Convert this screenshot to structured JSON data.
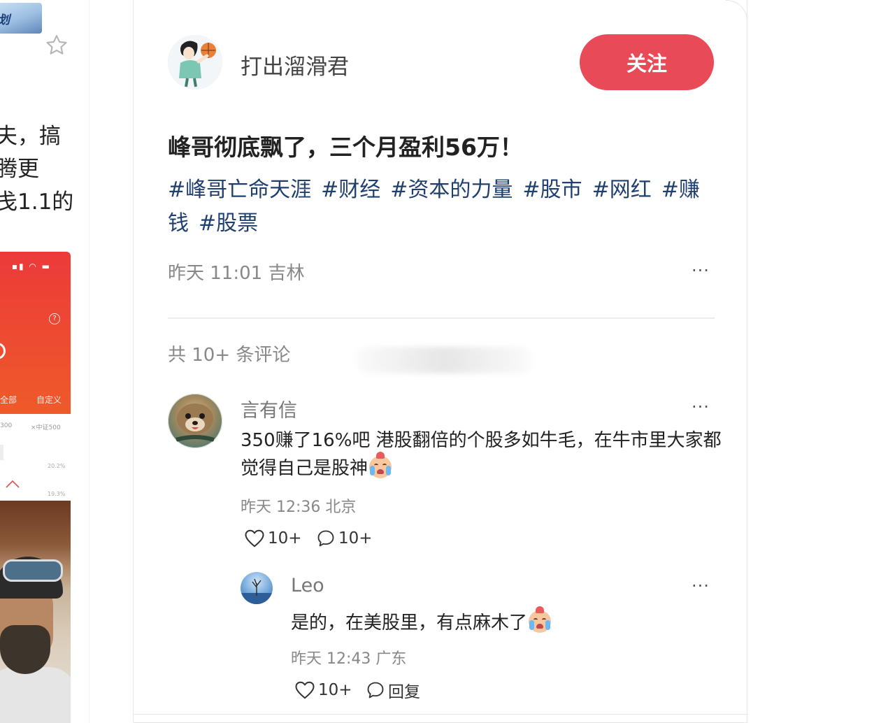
{
  "left_column": {
    "banner_text": "计划",
    "snippet_lines": [
      "夫，搞",
      "腾更",
      "戋1.1的"
    ],
    "phone_tabs": [
      "全部",
      "自定义"
    ],
    "legend_items": [
      "300",
      "×中证500"
    ],
    "percent_labels": [
      "20.2%",
      "19.3%"
    ]
  },
  "post": {
    "author_name": "打出溜滑君",
    "follow_label": "关注",
    "title": "峰哥彻底飘了，三个月盈利56万！",
    "tags": [
      "#峰哥亡命天涯",
      "#财经",
      "#资本的力量",
      "#股市",
      "#网红",
      "#赚钱",
      "#股票"
    ],
    "meta": "昨天 11:01 吉林",
    "more": "···"
  },
  "comments": {
    "count_label": "共 10+ 条评论",
    "items": [
      {
        "author": "言有信",
        "body": "350赚了16%吧 港股翻倍的个股多如牛毛，在牛市里大家都觉得自己是股神",
        "meta": "昨天 12:36 北京",
        "likes": "10+",
        "replies": "10+",
        "more": "···"
      },
      {
        "author": "Leo",
        "body": "是的，在美股里，有点麻木了",
        "meta": "昨天 12:43 广东",
        "likes": "10+",
        "reply_label": "回复",
        "more": "···"
      }
    ]
  },
  "icons": {
    "star": "star-outline-icon",
    "like": "heart-outline-icon",
    "reply": "speech-bubble-icon",
    "emoji": "crying-laughing-emoji"
  },
  "colors": {
    "follow_button": "#e94a57",
    "tag_link": "#1f3f70",
    "secondary_text": "#888888"
  }
}
